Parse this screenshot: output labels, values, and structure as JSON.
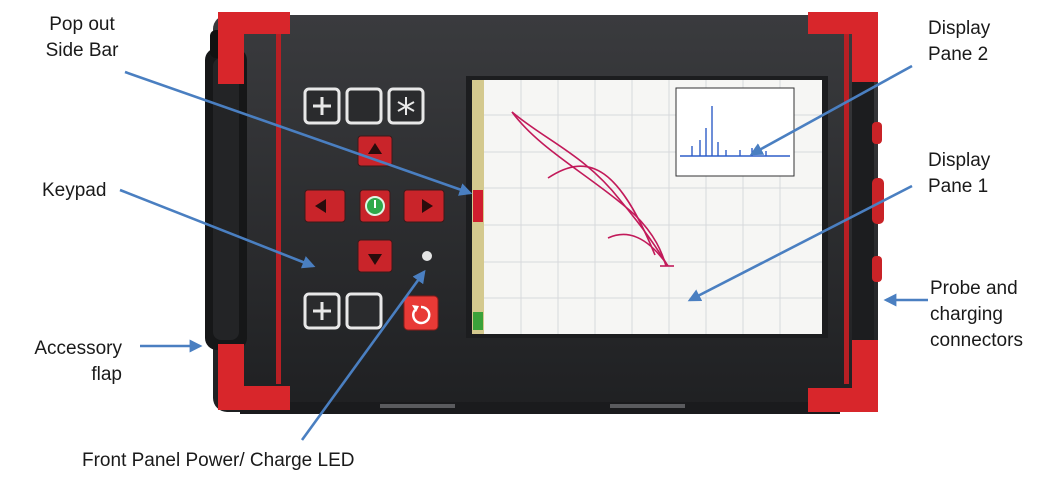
{
  "callouts": {
    "pop_out_side_bar": [
      "Pop out",
      "Side Bar"
    ],
    "display_pane_2": [
      "Display",
      "Pane 2"
    ],
    "display_pane_1": [
      "Display",
      "Pane 1"
    ],
    "keypad": "Keypad",
    "probe_connectors": [
      "Probe and",
      "charging",
      "connectors"
    ],
    "accessory_flap": [
      "Accessory",
      "flap"
    ],
    "power_led": "Front Panel Power/ Charge LED"
  },
  "colors": {
    "arrow": "#4a7fc1",
    "body": "#2a2b2d",
    "bumper": "#d8262b",
    "screen": "#f6f6f4",
    "grid": "#d7d9dc",
    "trace": "#c21a5a",
    "spectrum": "#2f5ec8",
    "key_red": "#c9242a"
  },
  "icons": {
    "plus_key": "plus-icon",
    "freeze_key": "snowflake-icon",
    "up_key": "arrow-up-icon",
    "down_key": "arrow-down-icon",
    "left_key": "arrow-left-icon",
    "right_key": "arrow-right-icon",
    "power_key": "power-icon",
    "reset_key": "undo-icon"
  }
}
